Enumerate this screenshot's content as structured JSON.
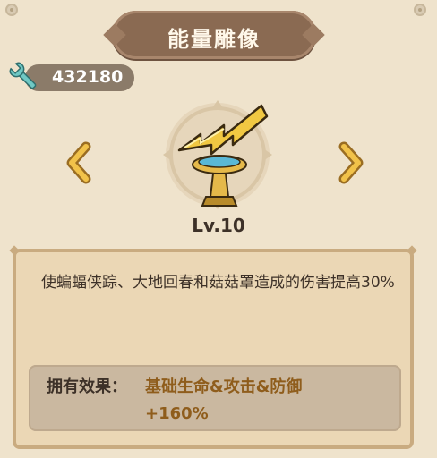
{
  "header": {
    "title": "能量雕像"
  },
  "currency": {
    "icon": "wrench-icon",
    "value": "432180"
  },
  "navigation": {
    "prev_icon": "chevron-left-icon",
    "next_icon": "chevron-right-icon"
  },
  "statue": {
    "icon": "lightning-statue-icon",
    "level": "Lv.10"
  },
  "description": {
    "text": "使蝙蝠侠踪、大地回春和菇菇罩造成的伤害提高30%"
  },
  "effect": {
    "label": "拥有效果：",
    "value": "基础生命&攻击&防御+160%"
  },
  "colors": {
    "background": "#efe3cc",
    "banner": "#8a6a52",
    "accent_gold": "#d7a72a",
    "effect_text": "#8f5d1c"
  }
}
